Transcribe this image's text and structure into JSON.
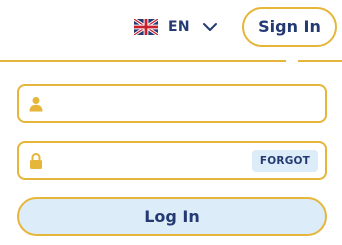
{
  "header": {
    "language": {
      "code": "EN",
      "flag_icon": "uk-flag-icon",
      "dropdown_icon": "chevron-down-icon"
    },
    "sign_in_label": "Sign In"
  },
  "login_form": {
    "username": {
      "icon": "user-icon",
      "value": "",
      "placeholder": ""
    },
    "password": {
      "icon": "lock-icon",
      "value": "",
      "placeholder": "",
      "forgot_label": "FORGOT"
    },
    "submit_label": "Log In"
  },
  "colors": {
    "accent_border": "#e6b63a",
    "text_navy": "#243a73",
    "button_fill": "#dcecf9"
  }
}
